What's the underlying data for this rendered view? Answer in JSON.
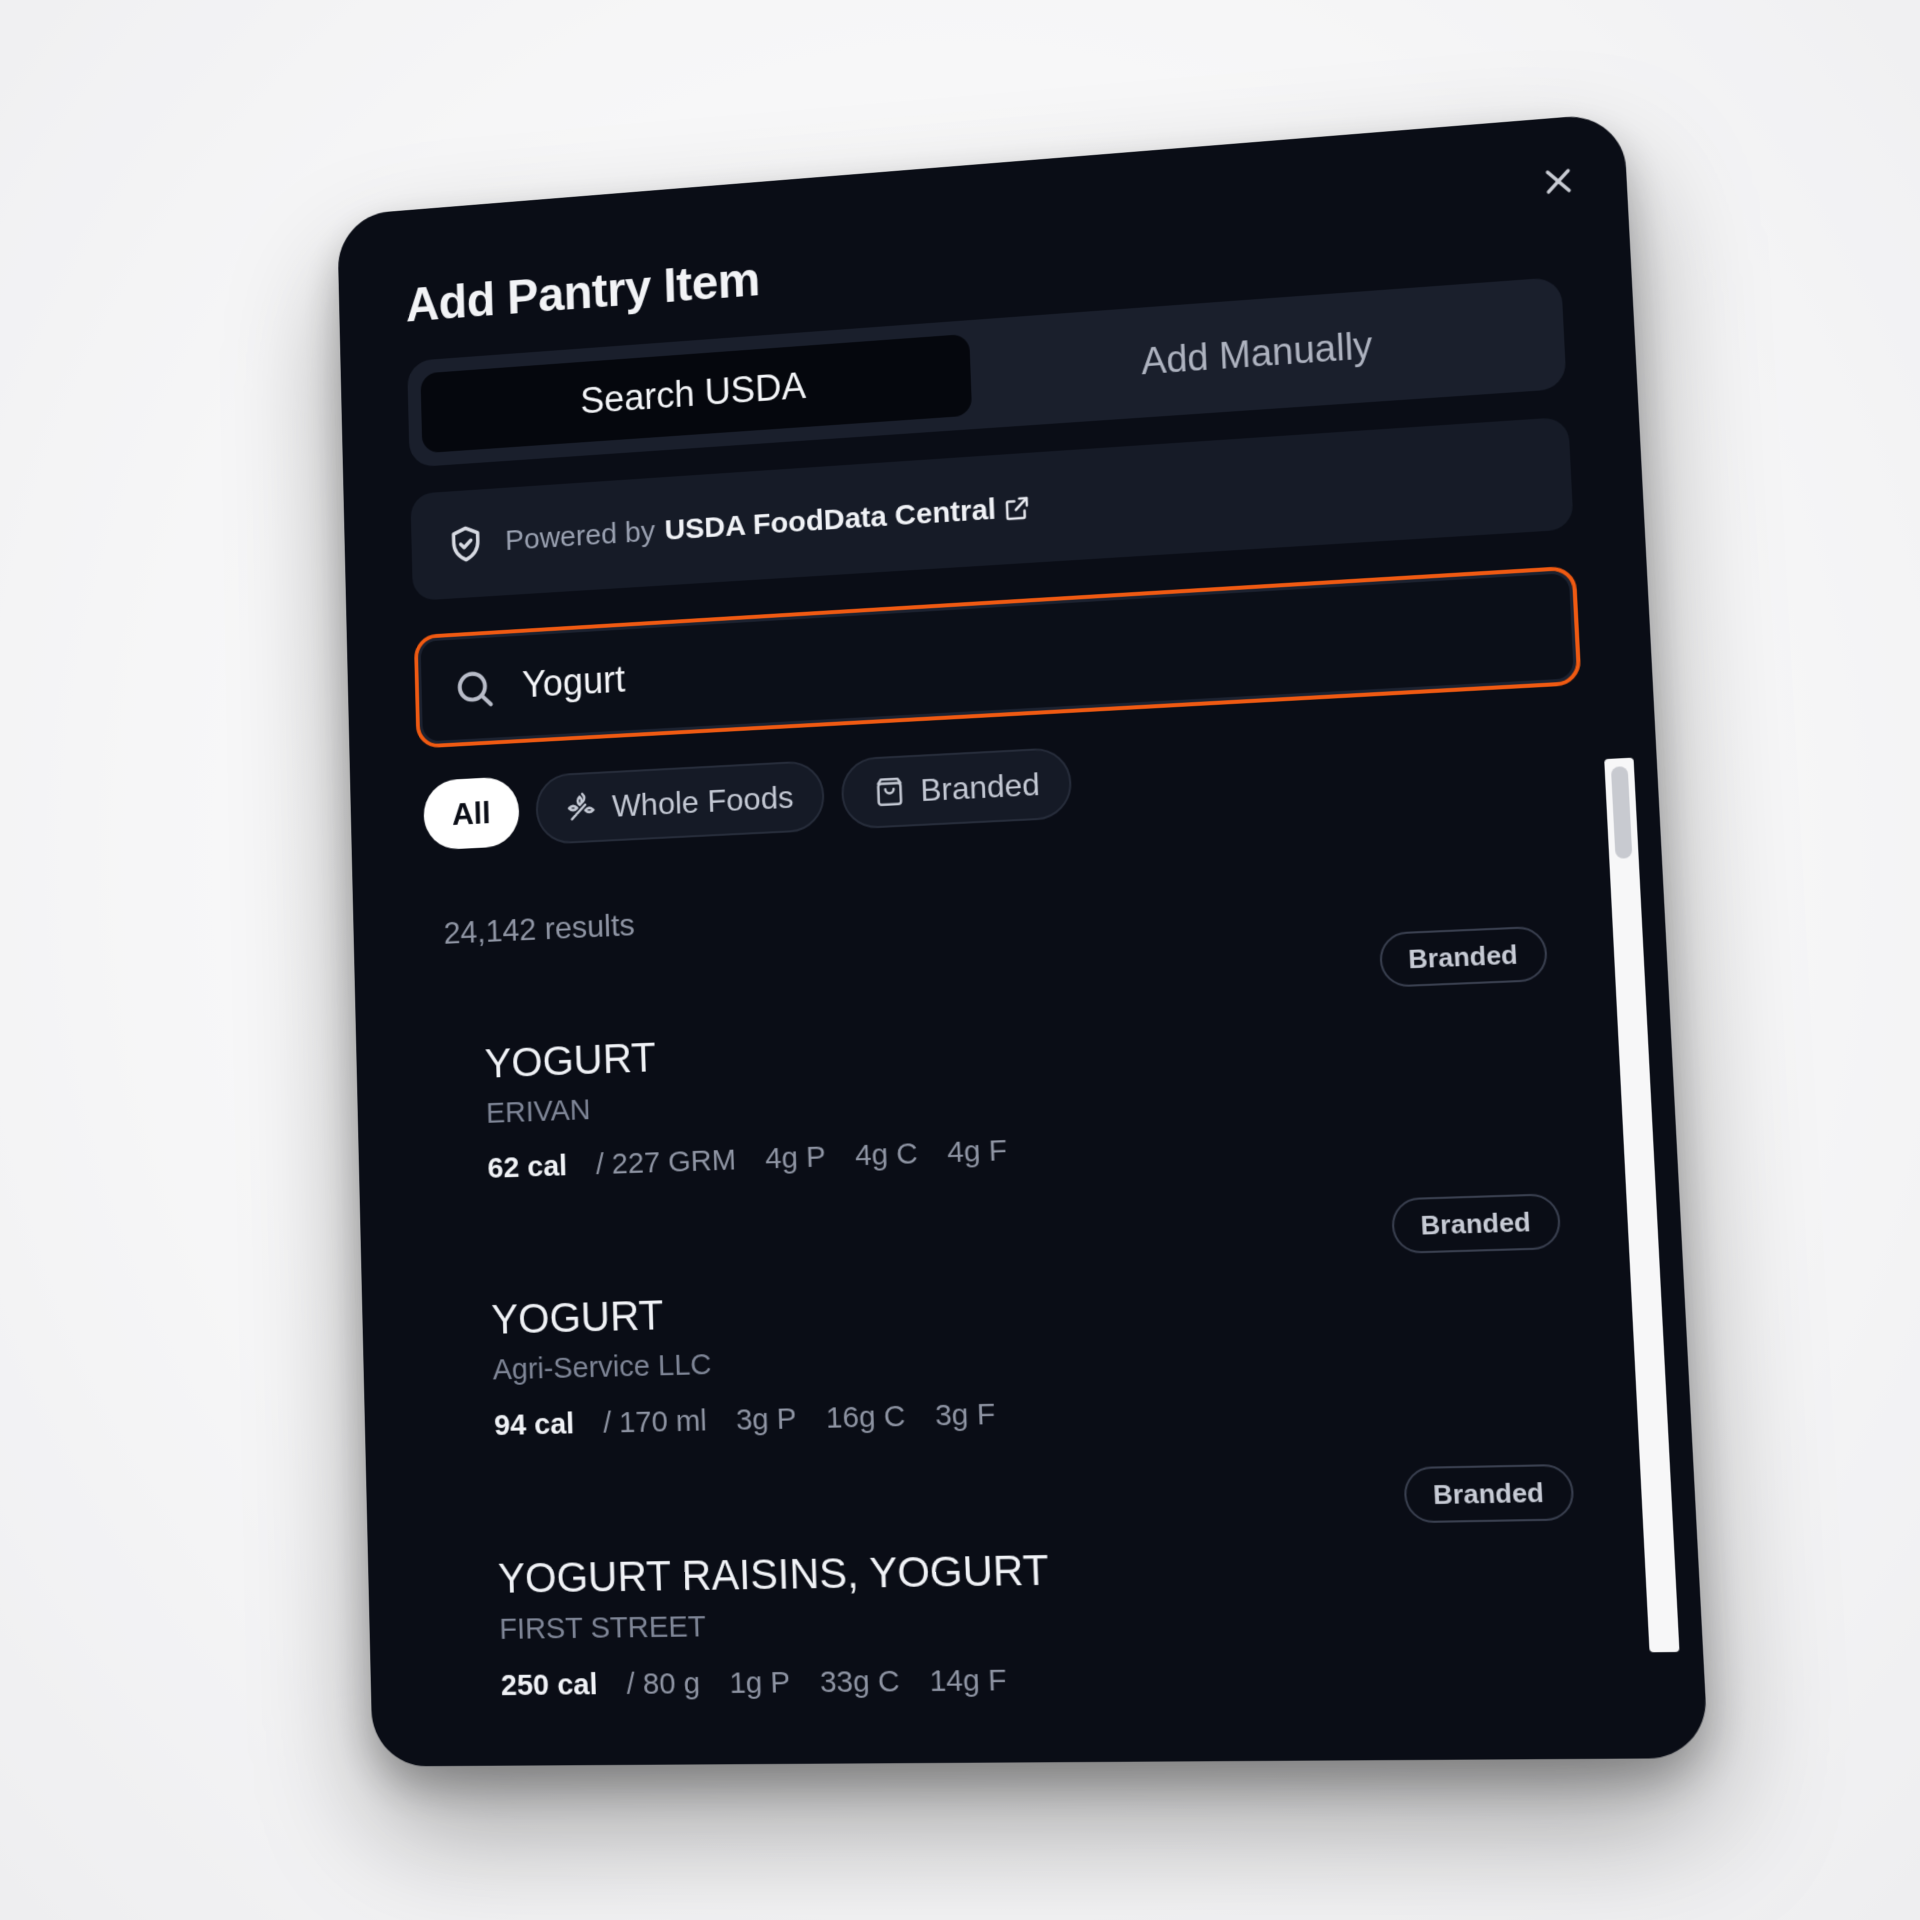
{
  "modal": {
    "title": "Add Pantry Item"
  },
  "tabs": [
    {
      "label": "Search USDA",
      "active": true
    },
    {
      "label": "Add Manually",
      "active": false
    }
  ],
  "powered": {
    "prefix": "Powered by",
    "source": "USDA FoodData Central",
    "icon": "shield-check-icon"
  },
  "search": {
    "value": "Yogurt",
    "accent": "#f05a12"
  },
  "filters": [
    {
      "label": "All",
      "selected": true,
      "icon": ""
    },
    {
      "label": "Whole Foods",
      "selected": false,
      "icon": "wheat-icon"
    },
    {
      "label": "Branded",
      "selected": false,
      "icon": "shopping-bag-icon"
    }
  ],
  "results": {
    "count_label": "24,142 results",
    "items": [
      {
        "badge": "Branded",
        "name": "YOGURT",
        "brand": "ERIVAN",
        "cal": "62 cal",
        "serving": "/ 227 GRM",
        "protein": "4g P",
        "carbs": "4g C",
        "fat": "4g F"
      },
      {
        "badge": "Branded",
        "name": "YOGURT",
        "brand": "Agri-Service LLC",
        "cal": "94 cal",
        "serving": "/ 170 ml",
        "protein": "3g P",
        "carbs": "16g C",
        "fat": "3g F"
      },
      {
        "badge": "Branded",
        "name": "YOGURT RAISINS, YOGURT",
        "brand": "FIRST STREET",
        "cal": "250 cal",
        "serving": "/ 80 g",
        "protein": "1g P",
        "carbs": "33g C",
        "fat": "14g F"
      }
    ]
  }
}
